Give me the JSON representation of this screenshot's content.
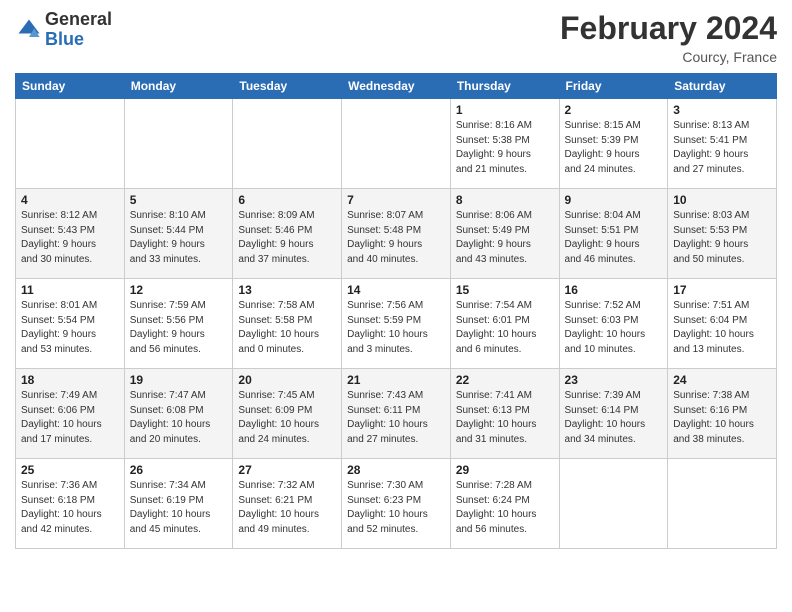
{
  "header": {
    "logo_general": "General",
    "logo_blue": "Blue",
    "title": "February 2024",
    "subtitle": "Courcy, France"
  },
  "calendar": {
    "days_of_week": [
      "Sunday",
      "Monday",
      "Tuesday",
      "Wednesday",
      "Thursday",
      "Friday",
      "Saturday"
    ],
    "weeks": [
      [
        {
          "day": "",
          "detail": ""
        },
        {
          "day": "",
          "detail": ""
        },
        {
          "day": "",
          "detail": ""
        },
        {
          "day": "",
          "detail": ""
        },
        {
          "day": "1",
          "detail": "Sunrise: 8:16 AM\nSunset: 5:38 PM\nDaylight: 9 hours\nand 21 minutes."
        },
        {
          "day": "2",
          "detail": "Sunrise: 8:15 AM\nSunset: 5:39 PM\nDaylight: 9 hours\nand 24 minutes."
        },
        {
          "day": "3",
          "detail": "Sunrise: 8:13 AM\nSunset: 5:41 PM\nDaylight: 9 hours\nand 27 minutes."
        }
      ],
      [
        {
          "day": "4",
          "detail": "Sunrise: 8:12 AM\nSunset: 5:43 PM\nDaylight: 9 hours\nand 30 minutes."
        },
        {
          "day": "5",
          "detail": "Sunrise: 8:10 AM\nSunset: 5:44 PM\nDaylight: 9 hours\nand 33 minutes."
        },
        {
          "day": "6",
          "detail": "Sunrise: 8:09 AM\nSunset: 5:46 PM\nDaylight: 9 hours\nand 37 minutes."
        },
        {
          "day": "7",
          "detail": "Sunrise: 8:07 AM\nSunset: 5:48 PM\nDaylight: 9 hours\nand 40 minutes."
        },
        {
          "day": "8",
          "detail": "Sunrise: 8:06 AM\nSunset: 5:49 PM\nDaylight: 9 hours\nand 43 minutes."
        },
        {
          "day": "9",
          "detail": "Sunrise: 8:04 AM\nSunset: 5:51 PM\nDaylight: 9 hours\nand 46 minutes."
        },
        {
          "day": "10",
          "detail": "Sunrise: 8:03 AM\nSunset: 5:53 PM\nDaylight: 9 hours\nand 50 minutes."
        }
      ],
      [
        {
          "day": "11",
          "detail": "Sunrise: 8:01 AM\nSunset: 5:54 PM\nDaylight: 9 hours\nand 53 minutes."
        },
        {
          "day": "12",
          "detail": "Sunrise: 7:59 AM\nSunset: 5:56 PM\nDaylight: 9 hours\nand 56 minutes."
        },
        {
          "day": "13",
          "detail": "Sunrise: 7:58 AM\nSunset: 5:58 PM\nDaylight: 10 hours\nand 0 minutes."
        },
        {
          "day": "14",
          "detail": "Sunrise: 7:56 AM\nSunset: 5:59 PM\nDaylight: 10 hours\nand 3 minutes."
        },
        {
          "day": "15",
          "detail": "Sunrise: 7:54 AM\nSunset: 6:01 PM\nDaylight: 10 hours\nand 6 minutes."
        },
        {
          "day": "16",
          "detail": "Sunrise: 7:52 AM\nSunset: 6:03 PM\nDaylight: 10 hours\nand 10 minutes."
        },
        {
          "day": "17",
          "detail": "Sunrise: 7:51 AM\nSunset: 6:04 PM\nDaylight: 10 hours\nand 13 minutes."
        }
      ],
      [
        {
          "day": "18",
          "detail": "Sunrise: 7:49 AM\nSunset: 6:06 PM\nDaylight: 10 hours\nand 17 minutes."
        },
        {
          "day": "19",
          "detail": "Sunrise: 7:47 AM\nSunset: 6:08 PM\nDaylight: 10 hours\nand 20 minutes."
        },
        {
          "day": "20",
          "detail": "Sunrise: 7:45 AM\nSunset: 6:09 PM\nDaylight: 10 hours\nand 24 minutes."
        },
        {
          "day": "21",
          "detail": "Sunrise: 7:43 AM\nSunset: 6:11 PM\nDaylight: 10 hours\nand 27 minutes."
        },
        {
          "day": "22",
          "detail": "Sunrise: 7:41 AM\nSunset: 6:13 PM\nDaylight: 10 hours\nand 31 minutes."
        },
        {
          "day": "23",
          "detail": "Sunrise: 7:39 AM\nSunset: 6:14 PM\nDaylight: 10 hours\nand 34 minutes."
        },
        {
          "day": "24",
          "detail": "Sunrise: 7:38 AM\nSunset: 6:16 PM\nDaylight: 10 hours\nand 38 minutes."
        }
      ],
      [
        {
          "day": "25",
          "detail": "Sunrise: 7:36 AM\nSunset: 6:18 PM\nDaylight: 10 hours\nand 42 minutes."
        },
        {
          "day": "26",
          "detail": "Sunrise: 7:34 AM\nSunset: 6:19 PM\nDaylight: 10 hours\nand 45 minutes."
        },
        {
          "day": "27",
          "detail": "Sunrise: 7:32 AM\nSunset: 6:21 PM\nDaylight: 10 hours\nand 49 minutes."
        },
        {
          "day": "28",
          "detail": "Sunrise: 7:30 AM\nSunset: 6:23 PM\nDaylight: 10 hours\nand 52 minutes."
        },
        {
          "day": "29",
          "detail": "Sunrise: 7:28 AM\nSunset: 6:24 PM\nDaylight: 10 hours\nand 56 minutes."
        },
        {
          "day": "",
          "detail": ""
        },
        {
          "day": "",
          "detail": ""
        }
      ]
    ]
  }
}
